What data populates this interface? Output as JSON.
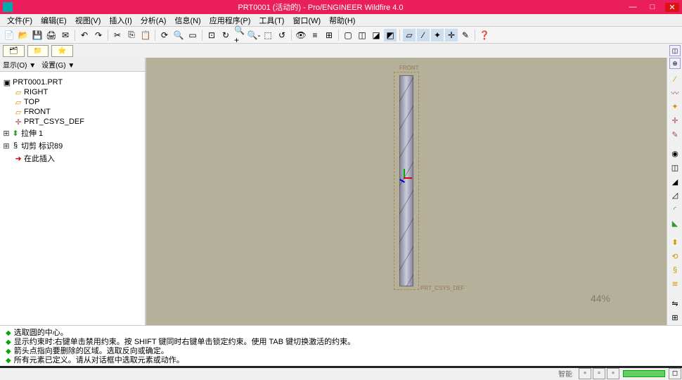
{
  "titlebar": {
    "title": "PRT0001 (活动的) - Pro/ENGINEER Wildfire 4.0"
  },
  "menu": {
    "file": "文件(F)",
    "edit": "编辑(E)",
    "view": "视图(V)",
    "insert": "插入(I)",
    "analysis": "分析(A)",
    "info": "信息(N)",
    "app": "应用程序(P)",
    "tools": "工具(T)",
    "window": "窗口(W)",
    "help": "帮助(H)"
  },
  "tabs": {
    "show": "显示(O) ▼",
    "settings": "设置(G) ▼"
  },
  "tree": {
    "root": "PRT0001.PRT",
    "right": "RIGHT",
    "top": "TOP",
    "front": "FRONT",
    "csys": "PRT_CSYS_DEF",
    "extrude": "拉伸 1",
    "sweep": "切剪 标识89",
    "insert": "在此插入"
  },
  "viewport": {
    "label_top": "FRONT",
    "label_bot": "PRT_CSYS_DEF",
    "zoom": "44%"
  },
  "messages": {
    "m1": "选取圆的中心。",
    "m2": "显示约束时:右键单击禁用约束。按 SHIFT 键同时右键单击锁定约束。使用 TAB 键切换激活的约束。",
    "m3": "箭头点指向要删除的区域。选取反向或确定。",
    "m4": "所有元素已定义。请从对话框中选取元素或动作。"
  },
  "status": {
    "smart": "智能"
  }
}
